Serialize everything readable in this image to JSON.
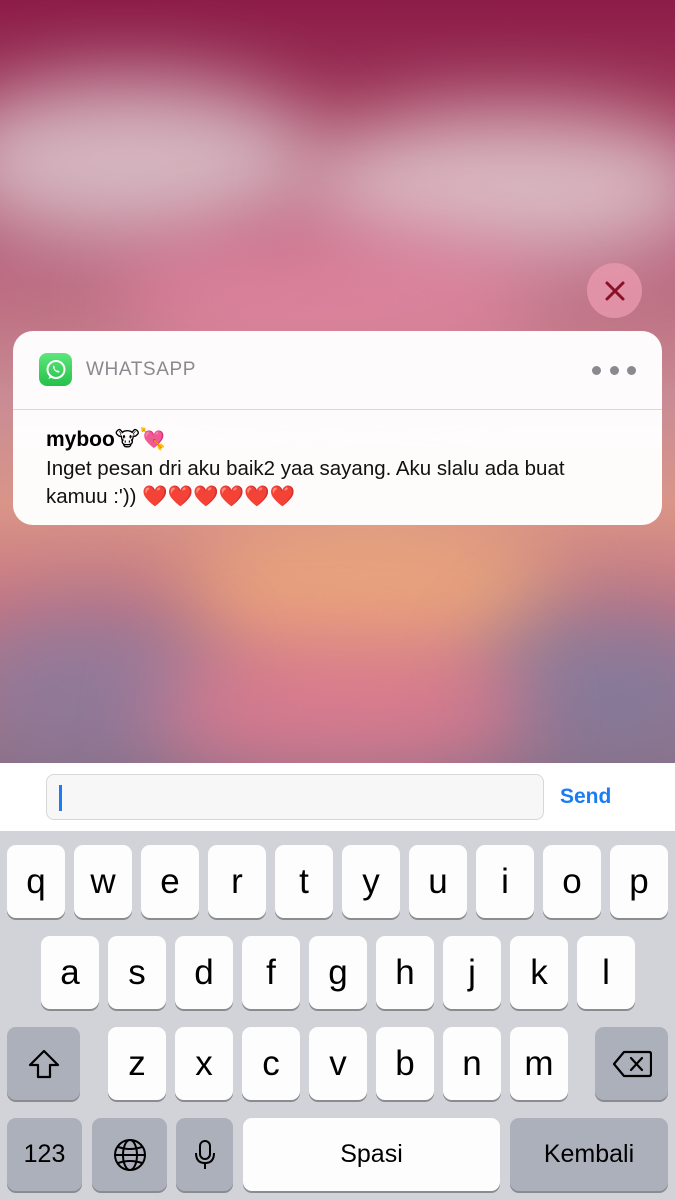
{
  "notification": {
    "app_name": "WHATSAPP",
    "sender": "myboo🐮💘",
    "message": "Inget pesan dri aku baik2 yaa sayang. Aku slalu ada buat kamuu :')) ❤️❤️❤️❤️❤️❤️"
  },
  "reply": {
    "input_value": "",
    "send_label": "Send"
  },
  "keyboard": {
    "row1": [
      "q",
      "w",
      "e",
      "r",
      "t",
      "y",
      "u",
      "i",
      "o",
      "p"
    ],
    "row2": [
      "a",
      "s",
      "d",
      "f",
      "g",
      "h",
      "j",
      "k",
      "l"
    ],
    "row3": [
      "z",
      "x",
      "c",
      "v",
      "b",
      "n",
      "m"
    ],
    "numbers_label": "123",
    "space_label": "Spasi",
    "return_label": "Kembali"
  },
  "icons": {
    "close": "close-icon",
    "more": "more-icon",
    "app": "whatsapp-icon",
    "shift": "shift-icon",
    "delete": "backspace-icon",
    "globe": "globe-icon",
    "mic": "microphone-icon"
  },
  "colors": {
    "accent": "#1d7cf2",
    "whatsapp_green": "#25c04a",
    "keyboard_bg": "#d1d3d9"
  }
}
